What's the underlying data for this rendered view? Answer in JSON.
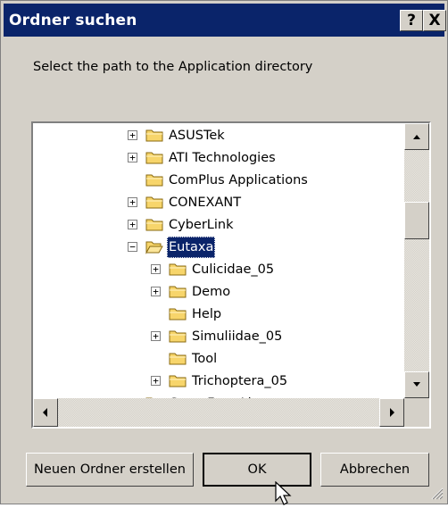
{
  "window": {
    "title": "Ordner suchen",
    "help_label": "?",
    "close_label": "X"
  },
  "description": "Select the path to the Application directory",
  "tree": {
    "items": [
      {
        "label": "ASUSTek",
        "expander": "+",
        "level": 0,
        "selected": false
      },
      {
        "label": "ATI Technologies",
        "expander": "+",
        "level": 0,
        "selected": false
      },
      {
        "label": "ComPlus Applications",
        "expander": "",
        "level": 0,
        "selected": false
      },
      {
        "label": "CONEXANT",
        "expander": "+",
        "level": 0,
        "selected": false
      },
      {
        "label": "CyberLink",
        "expander": "+",
        "level": 0,
        "selected": false
      },
      {
        "label": "Eutaxa",
        "expander": "−",
        "level": 0,
        "selected": true
      },
      {
        "label": "Culicidae_05",
        "expander": "+",
        "level": 1,
        "selected": false
      },
      {
        "label": "Demo",
        "expander": "+",
        "level": 1,
        "selected": false
      },
      {
        "label": "Help",
        "expander": "",
        "level": 1,
        "selected": false
      },
      {
        "label": "Simuliidae_05",
        "expander": "+",
        "level": 1,
        "selected": false
      },
      {
        "label": "Tool",
        "expander": "",
        "level": 1,
        "selected": false
      },
      {
        "label": "Trichoptera_05",
        "expander": "+",
        "level": 1,
        "selected": false
      },
      {
        "label": "GameFace Live",
        "expander": "+",
        "level": 0,
        "selected": false
      }
    ]
  },
  "buttons": {
    "new_folder": "Neuen Ordner erstellen",
    "ok": "OK",
    "cancel": "Abbrechen"
  },
  "icons": {
    "folder": "folder-icon",
    "folder_open": "open-folder-icon",
    "scroll_up": "arrow-up-icon",
    "scroll_down": "arrow-down-icon",
    "scroll_left": "arrow-left-icon",
    "scroll_right": "arrow-right-icon"
  },
  "colors": {
    "titlebar": "#0a246a",
    "selection": "#0a246a",
    "dialog": "#d4d0c8",
    "folder_fill": "#f7d56b"
  },
  "scroll": {
    "vertical_position_fraction": 0.28
  }
}
